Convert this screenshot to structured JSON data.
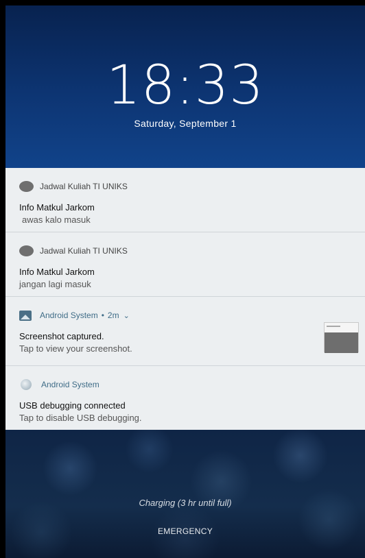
{
  "lockscreen": {
    "time": "18:33",
    "date": "Saturday, September 1"
  },
  "notifications": [
    {
      "app": "Jadwal Kuliah TI UNIKS",
      "title": "Info Matkul Jarkom",
      "text": "awas kalo masuk",
      "icon": "app-circle-icon"
    },
    {
      "app": "Jadwal Kuliah TI UNIKS",
      "title": "Info Matkul Jarkom",
      "text": "jangan lagi masuk",
      "icon": "app-circle-icon"
    },
    {
      "app": "Android System",
      "separator": "•",
      "age": "2m",
      "title": "Screenshot captured.",
      "text": "Tap to view your screenshot.",
      "icon": "image-icon",
      "expand_icon": "chevron-down-icon",
      "accent": "#3f6c87"
    },
    {
      "app": "Android System",
      "title": "USB debugging connected",
      "text": "Tap to disable USB debugging.",
      "icon": "android-system-icon",
      "accent": "#3f6c87"
    }
  ],
  "footer": {
    "charging": "Charging (3 hr until full)",
    "emergency": "EMERGENCY"
  },
  "colors": {
    "top_gradient_start": "#08224f",
    "top_gradient_end": "#11438a",
    "card_background": "#eceff1"
  }
}
